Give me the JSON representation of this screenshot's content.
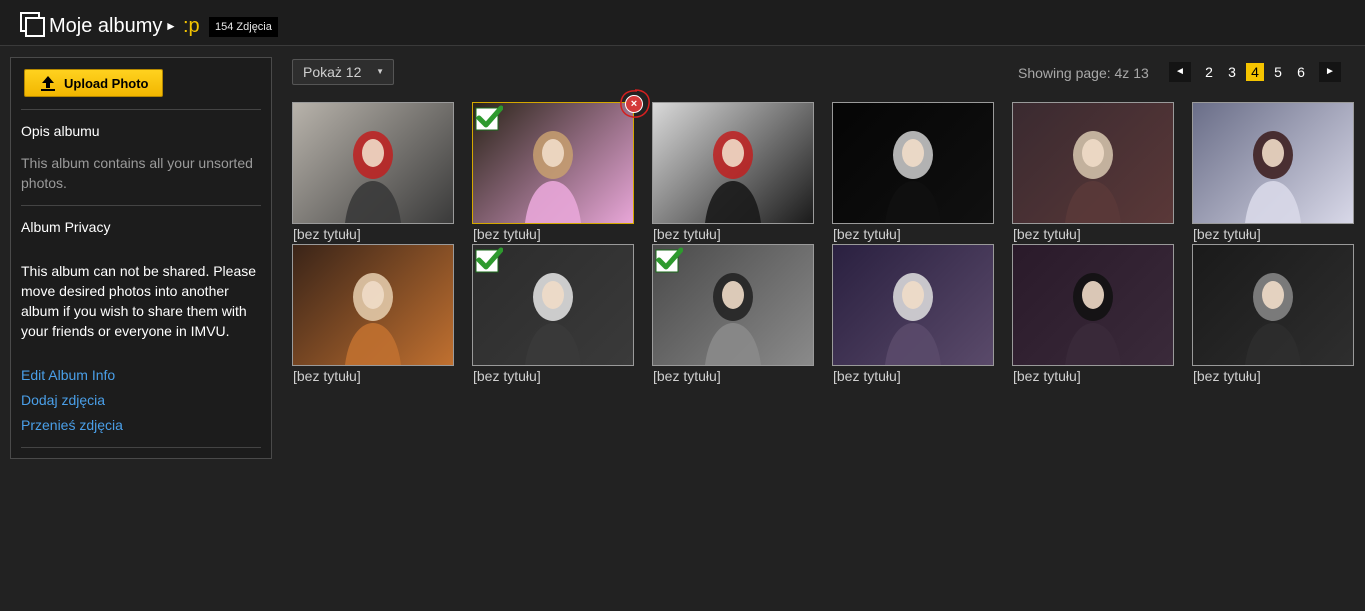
{
  "header": {
    "title": "Moje albumy",
    "arrow": "►",
    "album_name": ":p",
    "photo_count": "154 Zdjęcia"
  },
  "sidebar": {
    "upload_label": "Upload Photo",
    "desc_heading": "Opis albumu",
    "desc_text": "This album contains all your unsorted photos.",
    "privacy_heading": "Album Privacy",
    "privacy_text": "This album can not be shared. Please move desired photos into another album if you wish to share them with your friends or everyone in IMVU.",
    "links": [
      "Edit Album Info",
      "Dodaj zdjęcia",
      "Przenieś zdjęcia"
    ]
  },
  "toolbar": {
    "show_select": "Pokaż 12",
    "showing_text": "Showing page: 4z 13",
    "prev_arrow": "◄",
    "next_arrow": "►",
    "pages": [
      "2",
      "3",
      "4",
      "5",
      "6"
    ],
    "current_page": "4"
  },
  "photos": [
    {
      "caption": "[bez tytułu]",
      "checked": false
    },
    {
      "caption": "[bez tytułu]",
      "checked": true
    },
    {
      "caption": "[bez tytułu]",
      "checked": false
    },
    {
      "caption": "[bez tytułu]",
      "checked": false
    },
    {
      "caption": "[bez tytułu]",
      "checked": false
    },
    {
      "caption": "[bez tytułu]",
      "checked": false
    },
    {
      "caption": "[bez tytułu]",
      "checked": false
    },
    {
      "caption": "[bez tytułu]",
      "checked": true
    },
    {
      "caption": "[bez tytułu]",
      "checked": true
    },
    {
      "caption": "[bez tytułu]",
      "checked": false
    },
    {
      "caption": "[bez tytułu]",
      "checked": false
    },
    {
      "caption": "[bez tytułu]",
      "checked": false
    }
  ],
  "delete_icon": "×",
  "colors": {
    "accent": "#f5c400",
    "link": "#4a9fe8",
    "check": "#2e9a2e",
    "delete": "#d43a3a"
  }
}
